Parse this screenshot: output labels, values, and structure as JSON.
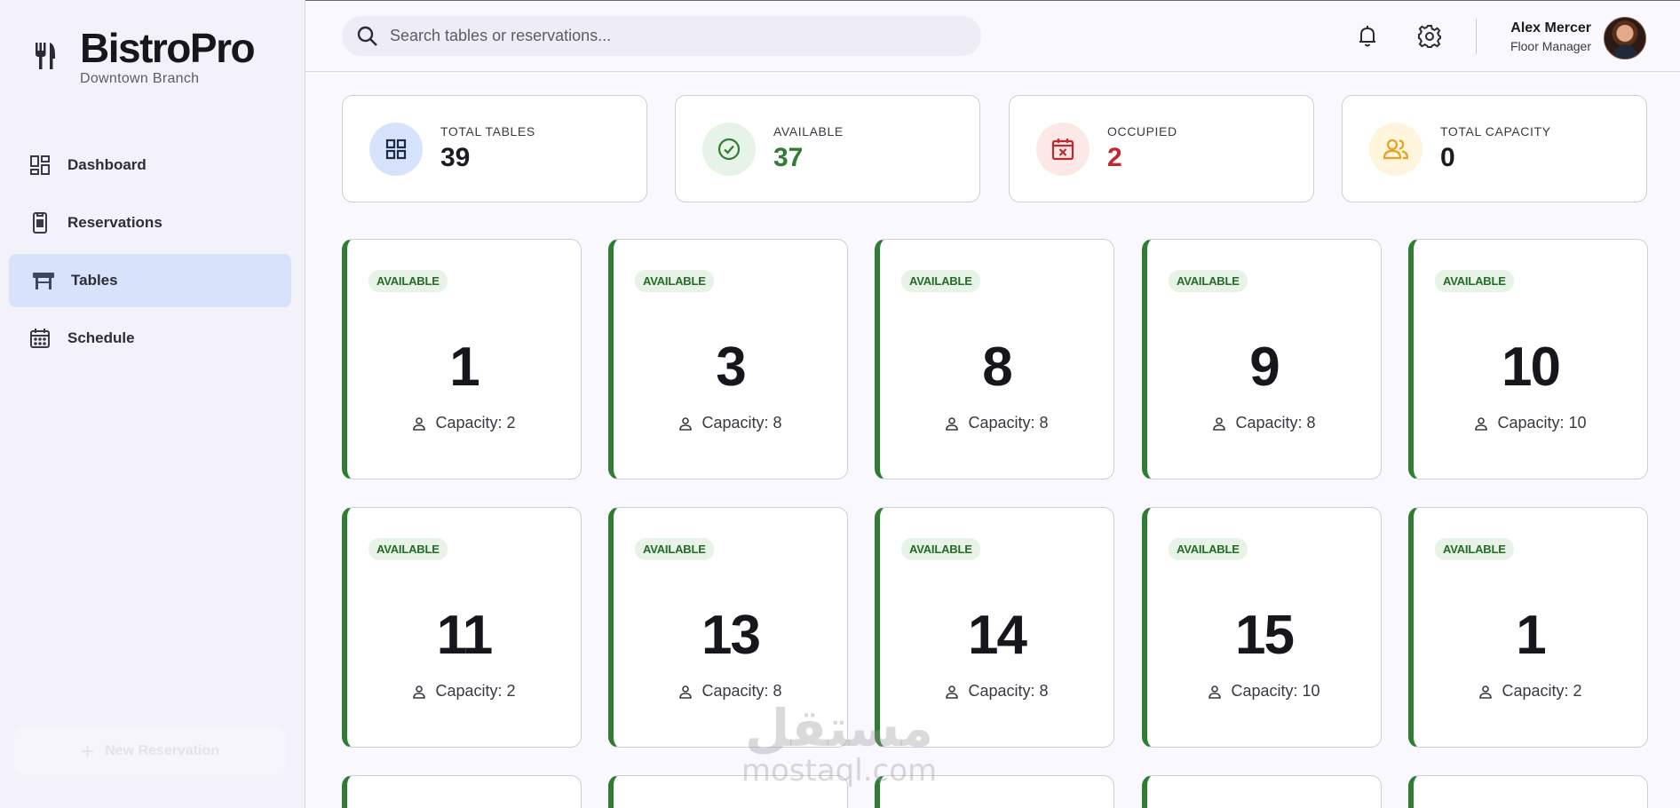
{
  "app": {
    "name": "BistroPro",
    "branch": "Downtown Branch"
  },
  "sidebar": {
    "items": [
      {
        "label": "Dashboard",
        "icon": "dashboard-icon",
        "active": false
      },
      {
        "label": "Reservations",
        "icon": "reservations-icon",
        "active": false
      },
      {
        "label": "Tables",
        "icon": "table-icon",
        "active": true
      },
      {
        "label": "Schedule",
        "icon": "calendar-icon",
        "active": false
      }
    ],
    "new_button": "New Reservation"
  },
  "header": {
    "search_placeholder": "Search tables or reservations...",
    "user_name": "Alex Mercer",
    "user_role": "Floor Manager"
  },
  "stats": [
    {
      "label": "TOTAL TABLES",
      "value": "39",
      "color": "#1b1b21",
      "icon": "grid-icon",
      "icon_bg": "#d6e3fb"
    },
    {
      "label": "AVAILABLE",
      "value": "37",
      "color": "#2f7d32",
      "icon": "check-circle-icon",
      "icon_bg": "#e6f3e6"
    },
    {
      "label": "OCCUPIED",
      "value": "2",
      "color": "#c0282d",
      "icon": "calendar-x-icon",
      "icon_bg": "#fde8e8"
    },
    {
      "label": "TOTAL CAPACITY",
      "value": "0",
      "color": "#1b1b21",
      "icon": "group-icon",
      "icon_bg": "#fff5dc"
    }
  ],
  "tables": [
    {
      "number": "1",
      "status": "AVAILABLE",
      "capacity": "Capacity: 2"
    },
    {
      "number": "3",
      "status": "AVAILABLE",
      "capacity": "Capacity: 8"
    },
    {
      "number": "8",
      "status": "AVAILABLE",
      "capacity": "Capacity: 8"
    },
    {
      "number": "9",
      "status": "AVAILABLE",
      "capacity": "Capacity: 8"
    },
    {
      "number": "10",
      "status": "AVAILABLE",
      "capacity": "Capacity: 10"
    },
    {
      "number": "11",
      "status": "AVAILABLE",
      "capacity": "Capacity: 2"
    },
    {
      "number": "13",
      "status": "AVAILABLE",
      "capacity": "Capacity: 8"
    },
    {
      "number": "14",
      "status": "AVAILABLE",
      "capacity": "Capacity: 8"
    },
    {
      "number": "15",
      "status": "AVAILABLE",
      "capacity": "Capacity: 10"
    },
    {
      "number": "1",
      "status": "AVAILABLE",
      "capacity": "Capacity: 2"
    }
  ],
  "watermark": {
    "arabic": "مستقل",
    "latin": "mostaql.com"
  },
  "colors": {
    "accent": "#d6e3fb",
    "available": "#2f7d32",
    "occupied": "#c0282d"
  }
}
